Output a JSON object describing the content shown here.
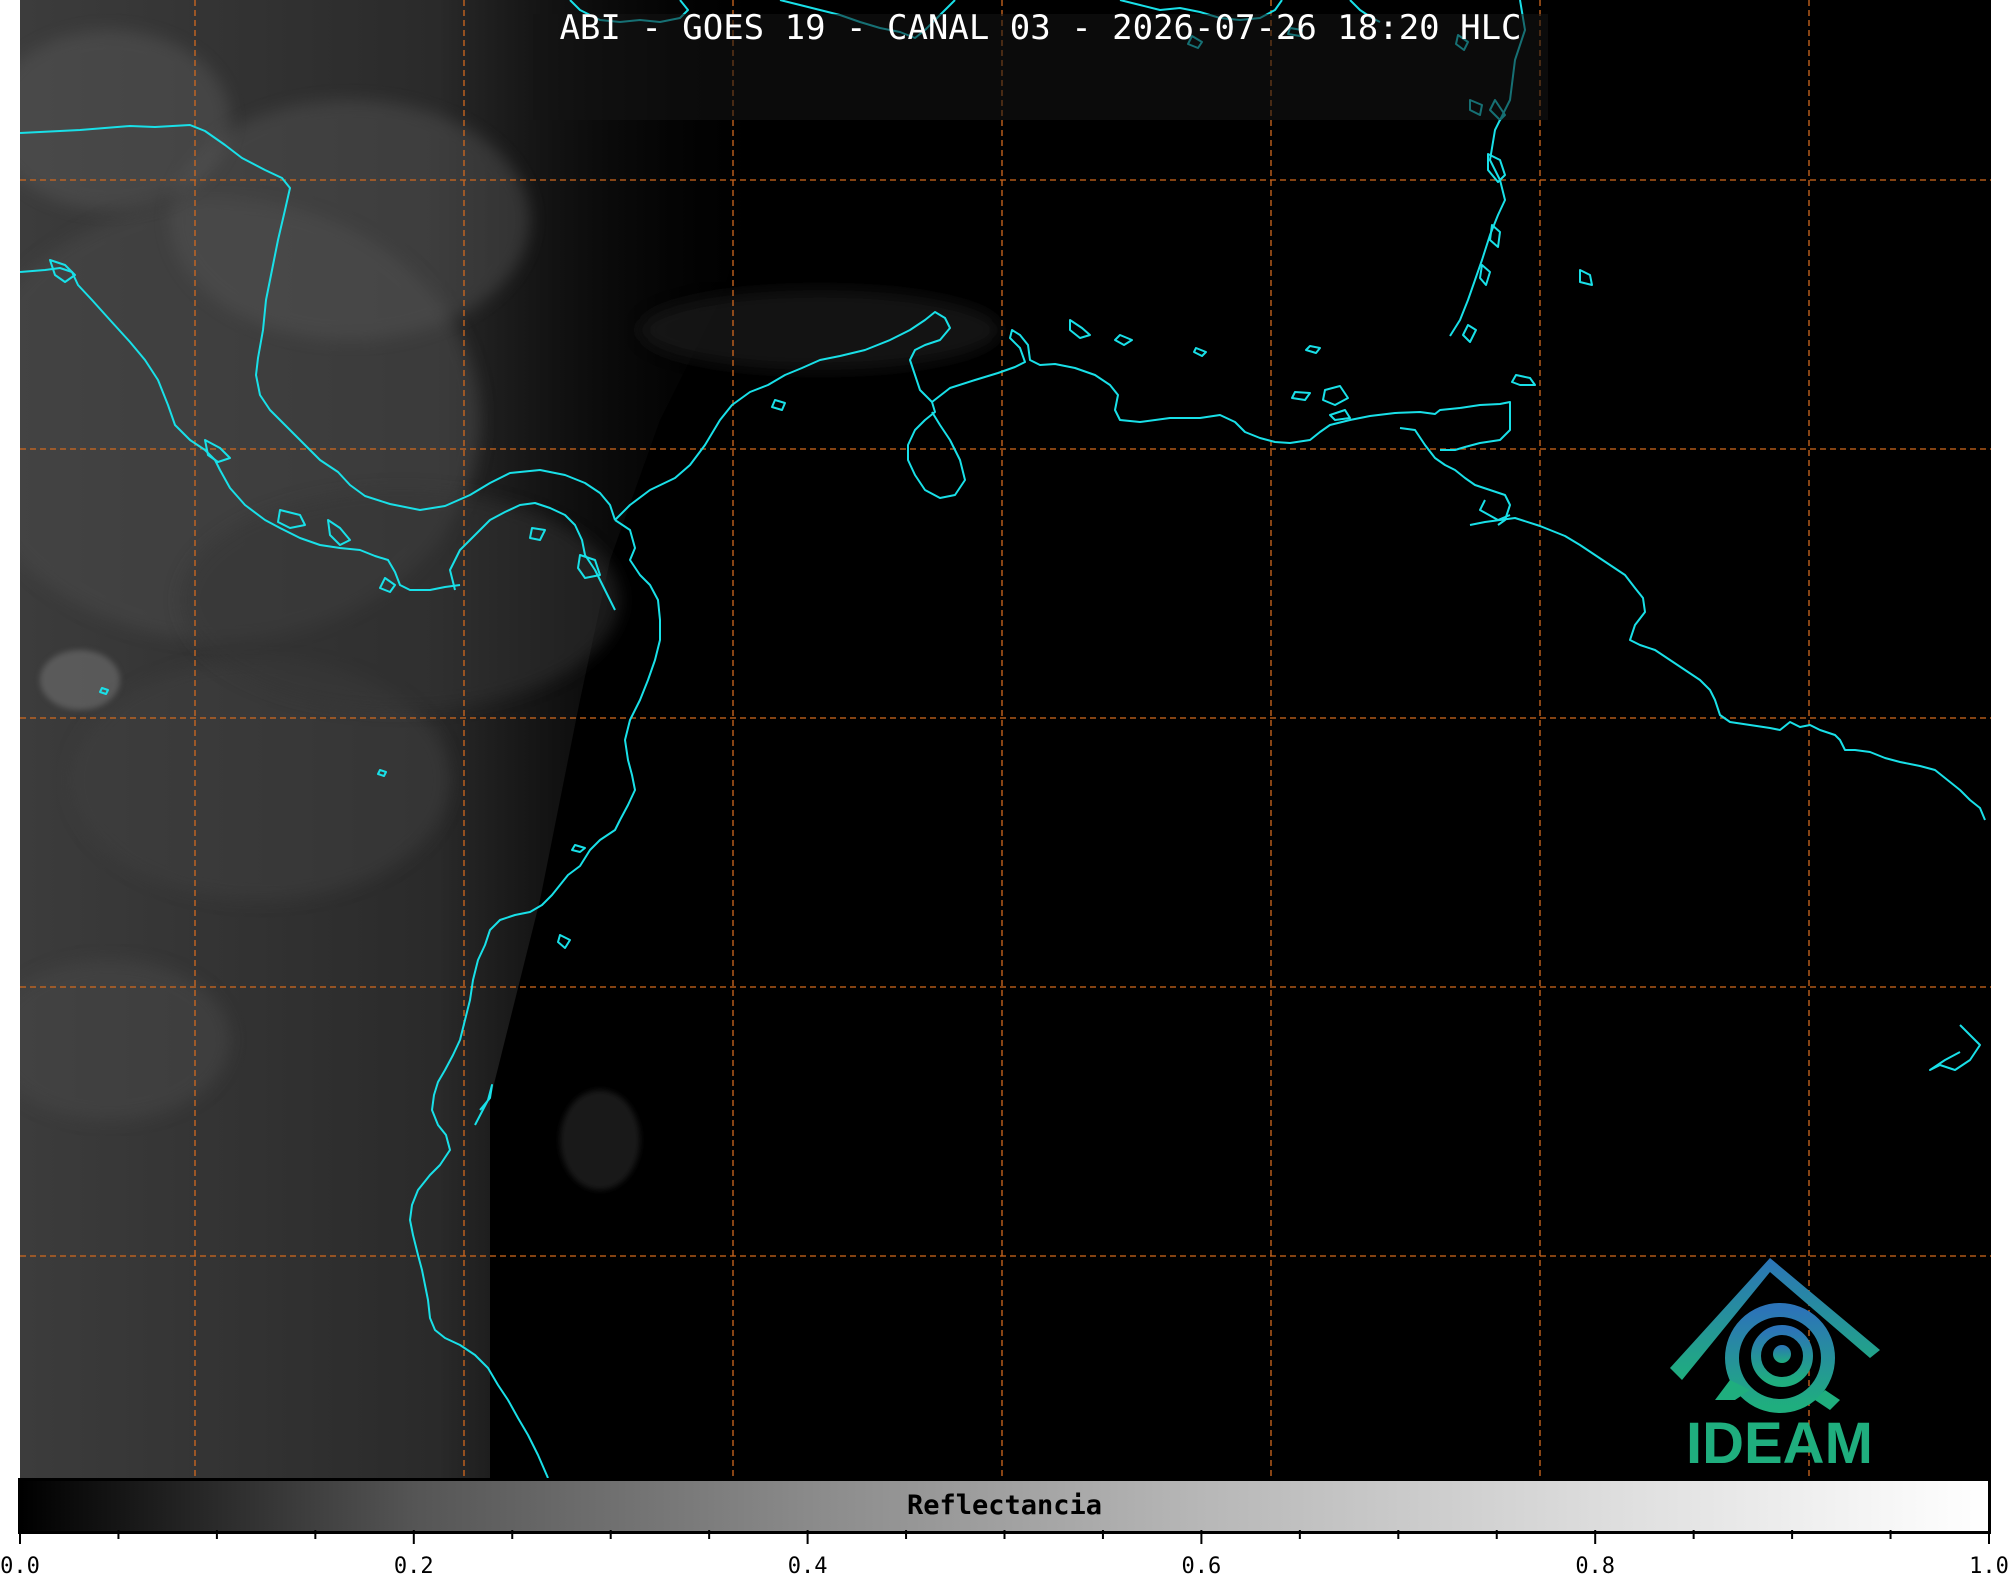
{
  "title": "ABI - GOES 19 - CANAL 03 - 2026-07-26 18:20 HLC",
  "colors": {
    "background": "#000000",
    "coastline": "#19e0e8",
    "grid": "#d2691e",
    "logo_blue": "#2c74b8",
    "logo_green": "#1fae7e"
  },
  "icons": {
    "logo": "ideam-logo-icon"
  },
  "logo": {
    "text": "IDEAM"
  },
  "colorbar": {
    "label": "Reflectancia",
    "ticks": [
      "0.0",
      "0.2",
      "0.4",
      "0.6",
      "0.8",
      "1.0"
    ],
    "range": [
      0.0,
      1.0
    ],
    "colormap": "grayscale"
  }
}
